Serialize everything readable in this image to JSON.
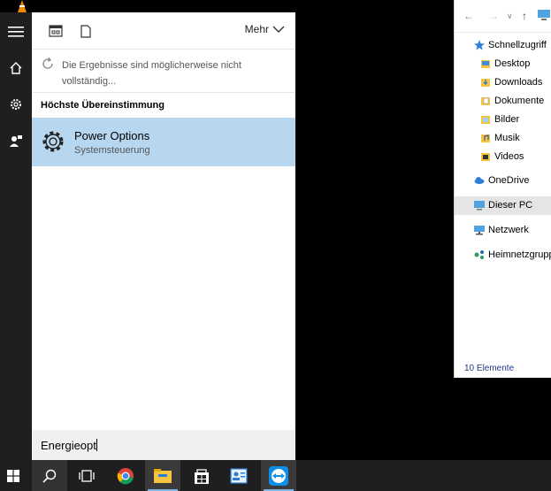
{
  "search_panel": {
    "more_label": "Mehr",
    "warning": "Die Ergebnisse sind möglicherweise nicht vollständig...",
    "best_match_heading": "Höchste Übereinstimmung",
    "result": {
      "title": "Power Options",
      "subtitle": "Systemsteuerung"
    },
    "query": "Energieopt"
  },
  "explorer": {
    "items": [
      {
        "label": "Schnellzugriff",
        "icon": "star-icon"
      },
      {
        "label": "Desktop",
        "icon": "folder-icon"
      },
      {
        "label": "Downloads",
        "icon": "downloads-folder-icon"
      },
      {
        "label": "Dokumente",
        "icon": "documents-folder-icon"
      },
      {
        "label": "Bilder",
        "icon": "pictures-folder-icon"
      },
      {
        "label": "Musik",
        "icon": "music-folder-icon"
      },
      {
        "label": "Videos",
        "icon": "videos-folder-icon"
      },
      {
        "label": "OneDrive",
        "icon": "cloud-icon"
      },
      {
        "label": "Dieser PC",
        "icon": "computer-icon"
      },
      {
        "label": "Netzwerk",
        "icon": "network-icon"
      },
      {
        "label": "Heimnetzgrupp",
        "icon": "homegroup-icon"
      }
    ],
    "status": "10 Elemente"
  },
  "taskbar": {
    "icons": [
      "windows-start-icon",
      "search-icon",
      "task-view-icon",
      "chrome-icon",
      "file-explorer-icon",
      "store-icon",
      "contacts-app-icon",
      "teamviewer-icon"
    ]
  },
  "colors": {
    "selection": "#b7d7f0",
    "taskbar": "#1f1f1f",
    "accent": "#0078d7"
  }
}
